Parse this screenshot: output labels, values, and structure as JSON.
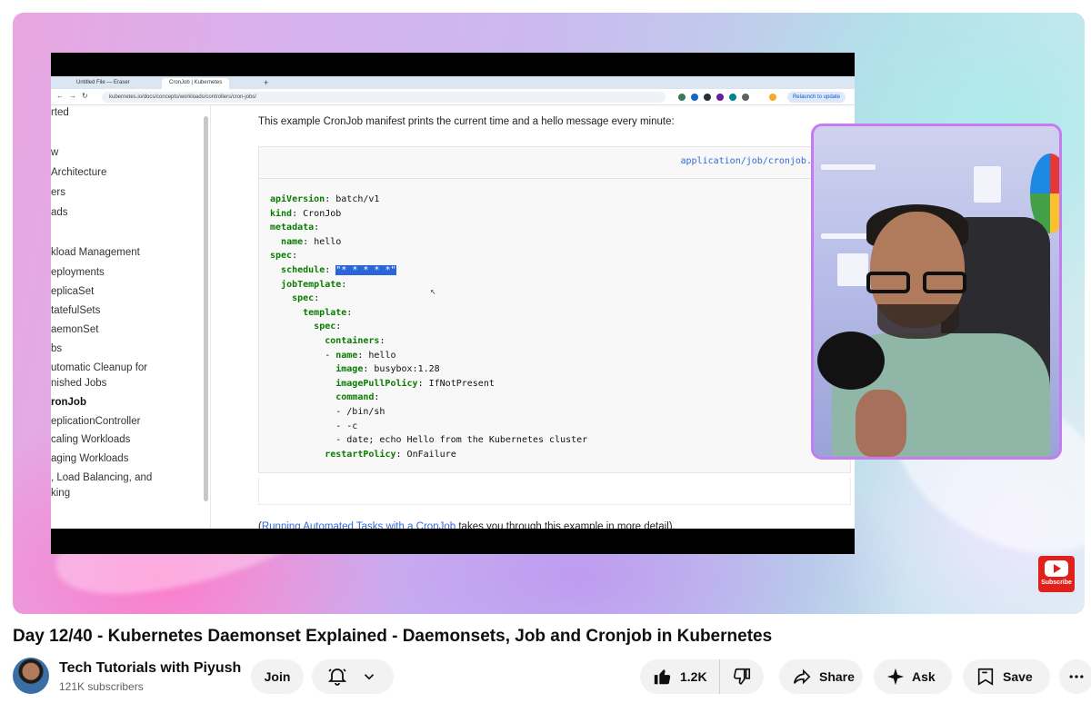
{
  "player": {
    "browser": {
      "tabs": [
        "Untitled File — Eraser",
        "CronJob | Kubernetes"
      ],
      "url": "kubernetes.io/docs/concepts/workloads/controllers/cron-jobs/",
      "relaunch_label": "Relaunch to update"
    },
    "docs": {
      "sidebar_items": [
        {
          "label": "rted",
          "bold": false
        },
        {
          "label": "w",
          "bold": false
        },
        {
          "label": "Architecture",
          "bold": false
        },
        {
          "label": "ers",
          "bold": false
        },
        {
          "label": "ads",
          "bold": false
        },
        {
          "label": "kload Management",
          "bold": false
        },
        {
          "label": "eployments",
          "bold": false
        },
        {
          "label": "eplicaSet",
          "bold": false
        },
        {
          "label": "tatefulSets",
          "bold": false
        },
        {
          "label": "aemonSet",
          "bold": false
        },
        {
          "label": "bs",
          "bold": false
        },
        {
          "label": "utomatic Cleanup for",
          "bold": false
        },
        {
          "label": "nished Jobs",
          "bold": false
        },
        {
          "label": "ronJob",
          "bold": true
        },
        {
          "label": "eplicationController",
          "bold": false
        },
        {
          "label": "caling Workloads",
          "bold": false
        },
        {
          "label": "aging Workloads",
          "bold": false
        },
        {
          "label": ", Load Balancing, and",
          "bold": false
        },
        {
          "label": "king",
          "bold": false
        }
      ],
      "intro": "This example CronJob manifest prints the current time and a hello message every minute:",
      "code_file": "application/job/cronjob.y",
      "code_lines": [
        {
          "indent": "",
          "key": "apiVersion",
          "value": " batch/v1"
        },
        {
          "indent": "",
          "key": "kind",
          "value": " CronJob"
        },
        {
          "indent": "",
          "key": "metadata",
          "value": ""
        },
        {
          "indent": "  ",
          "key": "name",
          "value": " hello"
        },
        {
          "indent": "",
          "key": "spec",
          "value": ""
        },
        {
          "indent": "  ",
          "key": "schedule",
          "value": " ",
          "selected": "\"* * * * *\""
        },
        {
          "indent": "  ",
          "key": "jobTemplate",
          "value": ""
        },
        {
          "indent": "    ",
          "key": "spec",
          "value": ""
        },
        {
          "indent": "      ",
          "key": "template",
          "value": ""
        },
        {
          "indent": "        ",
          "key": "spec",
          "value": ""
        },
        {
          "indent": "          ",
          "key": "containers",
          "value": ""
        },
        {
          "indent": "          - ",
          "key": "name",
          "value": " hello"
        },
        {
          "indent": "            ",
          "key": "image",
          "value": " busybox:1.28"
        },
        {
          "indent": "            ",
          "key": "imagePullPolicy",
          "value": " IfNotPresent"
        },
        {
          "indent": "            ",
          "key": "command",
          "value": ""
        },
        {
          "indent": "            ",
          "key": "",
          "value": "- /bin/sh",
          "plain": true
        },
        {
          "indent": "            ",
          "key": "",
          "value": "- -c",
          "plain": true
        },
        {
          "indent": "            ",
          "key": "",
          "value": "- date; echo Hello from the Kubernetes cluster",
          "plain": true
        },
        {
          "indent": "          ",
          "key": "restartPolicy",
          "value": " OnFailure"
        }
      ],
      "run_link_text": "Running Automated Tasks with a CronJob",
      "run_link_suffix": " takes you through this example in more detail)."
    },
    "subscribe_badge": "Subscribe"
  },
  "video": {
    "title": "Day 12/40 - Kubernetes Daemonset Explained - Daemonsets, Job and Cronjob in Kubernetes"
  },
  "channel": {
    "name": "Tech Tutorials with Piyush",
    "subscribers": "121K subscribers",
    "join_label": "Join"
  },
  "actions": {
    "likes": "1.2K",
    "share_label": "Share",
    "ask_label": "Ask",
    "save_label": "Save"
  },
  "icons": {
    "bell": "bell-icon",
    "chevron": "chevron-down-icon",
    "like": "thumbs-up-icon",
    "dislike": "thumbs-down-icon",
    "share": "share-arrow-icon",
    "ask": "sparkle-icon",
    "save": "save-bookmark-icon",
    "more": "more-horizontal-icon"
  },
  "colors": {
    "code_key": "#0a7b00",
    "selection": "#2b66d9",
    "link": "#3367d6",
    "webcam_border": "#c67cf0",
    "subscribe_red": "#e0201b"
  }
}
